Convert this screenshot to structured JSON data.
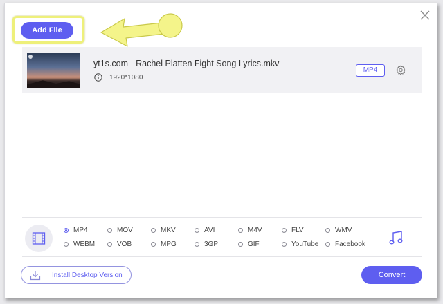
{
  "toolbar": {
    "add_file_label": "Add File"
  },
  "file": {
    "name": "yt1s.com - Rachel Platten Fight Song Lyrics.mkv",
    "resolution": "1920*1080",
    "output_format": "MP4"
  },
  "formats": {
    "selected": "MP4",
    "row1": [
      "MP4",
      "MOV",
      "MKV",
      "AVI",
      "M4V",
      "FLV",
      "WMV"
    ],
    "row2": [
      "WEBM",
      "VOB",
      "MPG",
      "3GP",
      "GIF",
      "YouTube",
      "Facebook"
    ]
  },
  "footer": {
    "install_label": "Install Desktop Version",
    "convert_label": "Convert"
  },
  "colors": {
    "accent": "#5e5ef0",
    "highlight": "#eef07a"
  },
  "icons": [
    "close-icon",
    "info-icon",
    "gear-icon",
    "film-icon",
    "music-note-icon",
    "download-icon"
  ]
}
